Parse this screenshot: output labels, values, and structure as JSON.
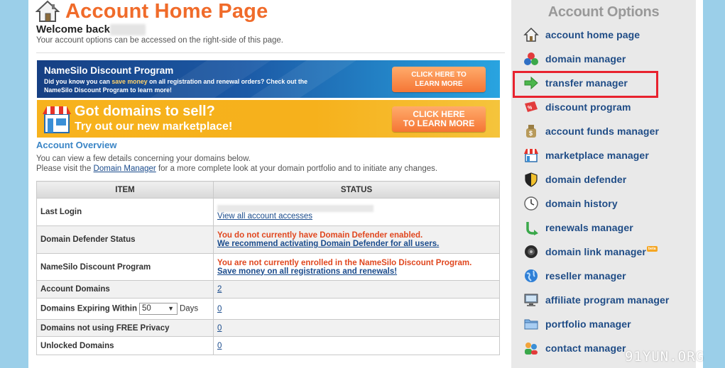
{
  "header": {
    "title": "Account Home Page",
    "welcome": "Welcome back",
    "welcome_sub": "Your account options can be accessed on the right-side of this page."
  },
  "banner_discount": {
    "title": "NameSilo Discount Program",
    "text_pre": "Did you know you can ",
    "text_emph": "save money",
    "text_post": " on all registration and renewal orders? Check out the NameSilo Discount Program to learn more!",
    "cta_line1": "CLICK HERE TO",
    "cta_line2": "LEARN MORE"
  },
  "banner_marketplace": {
    "title": "Got domains to sell?",
    "subtitle": "Try out our new marketplace!",
    "cta_line1": "CLICK HERE",
    "cta_line2": "TO LEARN MORE"
  },
  "overview": {
    "title": "Account Overview",
    "line1": "You can view a few details concerning your domains below.",
    "line2_pre": "Please visit the ",
    "line2_link": "Domain Manager",
    "line2_post": " for a more complete look at your domain portfolio and to initiate any changes."
  },
  "table": {
    "col_item": "ITEM",
    "col_status": "STATUS",
    "last_login": {
      "label": "Last Login",
      "link": "View all account accesses"
    },
    "defender": {
      "label": "Domain Defender Status",
      "warning": "You do not currently have Domain Defender enabled.",
      "link": "We recommend activating Domain Defender for all users."
    },
    "discount": {
      "label": "NameSilo Discount Program",
      "warning": "You are not currently enrolled in the NameSilo Discount Program.",
      "link": "Save money on all registrations and renewals!"
    },
    "account_domains": {
      "label": "Account Domains",
      "value": "2"
    },
    "expiring": {
      "label": "Domains Expiring Within",
      "select_value": "50",
      "unit": "Days",
      "value": "0"
    },
    "no_privacy": {
      "label": "Domains not using FREE Privacy",
      "value": "0"
    },
    "unlocked": {
      "label": "Unlocked Domains",
      "value": "0"
    }
  },
  "sidebar": {
    "title": "Account Options",
    "items": [
      {
        "label": "account home page",
        "icon": "house-icon"
      },
      {
        "label": "domain manager",
        "icon": "domain-manager-icon"
      },
      {
        "label": "transfer manager",
        "icon": "green-arrow-icon"
      },
      {
        "label": "discount program",
        "icon": "discount-tag-icon"
      },
      {
        "label": "account funds manager",
        "icon": "money-bag-icon"
      },
      {
        "label": "marketplace manager",
        "icon": "storefront-icon"
      },
      {
        "label": "domain defender",
        "icon": "shield-icon"
      },
      {
        "label": "domain history",
        "icon": "clock-icon"
      },
      {
        "label": "renewals manager",
        "icon": "renew-arrow-icon"
      },
      {
        "label": "domain link manager",
        "icon": "link-globe-icon",
        "badge": "beta"
      },
      {
        "label": "reseller manager",
        "icon": "globe-icon"
      },
      {
        "label": "affiliate program manager",
        "icon": "monitor-icon"
      },
      {
        "label": "portfolio manager",
        "icon": "folder-icon"
      },
      {
        "label": "contact manager",
        "icon": "contacts-icon"
      }
    ],
    "highlight_color": "#e8222e"
  },
  "watermark": "91YUN.ORG",
  "colors": {
    "title_orange": "#f06b2a",
    "link_blue": "#1f4c86",
    "warning_red": "#e0471f",
    "background_blue": "#9bcfe9"
  }
}
